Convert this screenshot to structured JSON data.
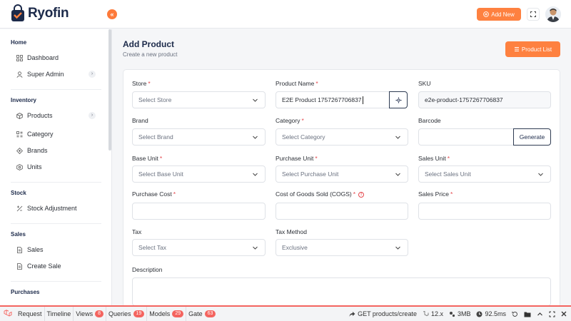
{
  "brand": {
    "name": "Ryofin"
  },
  "header": {
    "collapse_glyph": "«",
    "add_new_label": "Add New"
  },
  "sidebar": {
    "sections": [
      {
        "title": "Home"
      },
      {
        "title": "Inventory"
      },
      {
        "title": "Stock"
      },
      {
        "title": "Sales"
      },
      {
        "title": "Purchases"
      }
    ],
    "items": [
      {
        "label": "Dashboard",
        "icon": "grid-icon"
      },
      {
        "label": "Super Admin",
        "icon": "user-icon"
      },
      {
        "label": "Products",
        "icon": "box-icon"
      },
      {
        "label": "Category",
        "icon": "category-icon"
      },
      {
        "label": "Brands",
        "icon": "brand-icon"
      },
      {
        "label": "Units",
        "icon": "units-icon"
      },
      {
        "label": "Stock Adjustment",
        "icon": "adjust-icon"
      },
      {
        "label": "Sales",
        "icon": "document-icon"
      },
      {
        "label": "Create Sale",
        "icon": "document-icon"
      }
    ]
  },
  "page": {
    "title": "Add Product",
    "subtitle": "Create a new product",
    "product_list_label": "Product List"
  },
  "form": {
    "store": {
      "label": "Store",
      "required": "*",
      "value": "Select Store"
    },
    "product_name": {
      "label": "Product Name",
      "required": "*",
      "value": "E2E Product 1757267706837"
    },
    "sku": {
      "label": "SKU",
      "value": "e2e-product-1757267706837"
    },
    "brand": {
      "label": "Brand",
      "value": "Select Brand"
    },
    "category": {
      "label": "Category",
      "required": "*",
      "value": "Select Category"
    },
    "barcode": {
      "label": "Barcode",
      "value": "",
      "generate_label": "Generate"
    },
    "base_unit": {
      "label": "Base Unit",
      "required": "*",
      "value": "Select Base Unit"
    },
    "purchase_unit": {
      "label": "Purchase Unit",
      "required": "*",
      "value": "Select Purchase Unit"
    },
    "sales_unit": {
      "label": "Sales Unit",
      "required": "*",
      "value": "Select Sales Unit"
    },
    "purchase_cost": {
      "label": "Purchase Cost",
      "required": "*",
      "value": ""
    },
    "cogs": {
      "label": "Cost of Goods Sold (COGS)",
      "required": "*",
      "value": ""
    },
    "sales_price": {
      "label": "Sales Price",
      "required": "*",
      "value": ""
    },
    "tax": {
      "label": "Tax",
      "value": "Select Tax"
    },
    "tax_method": {
      "label": "Tax Method",
      "value": "Exclusive"
    },
    "description": {
      "label": "Description",
      "value": ""
    }
  },
  "debugbar": {
    "tabs": [
      {
        "label": "Request"
      },
      {
        "label": "Timeline"
      },
      {
        "label": "Views",
        "badge": "8"
      },
      {
        "label": "Queries",
        "badge": "19"
      },
      {
        "label": "Models",
        "badge": "29"
      },
      {
        "label": "Gate",
        "badge": "63"
      }
    ],
    "route": "GET products/create",
    "php_version": "12.x",
    "memory": "3MB",
    "time": "92.5ms"
  },
  "colors": {
    "accent": "#fe8140",
    "required": "#e5484d",
    "debug": "#f4645f"
  }
}
